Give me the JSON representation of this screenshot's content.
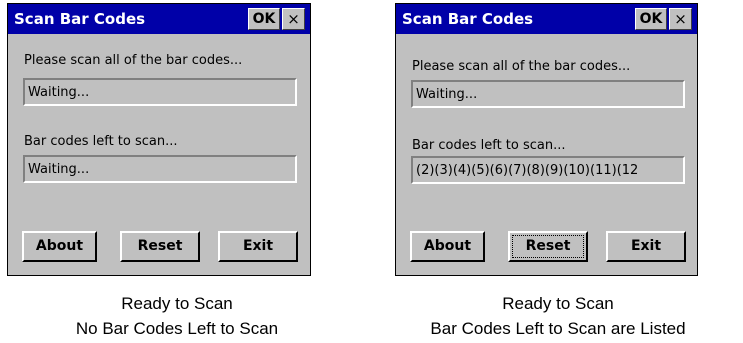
{
  "screens": [
    {
      "title": "Scan Bar Codes",
      "ok_label": "OK",
      "close_label": "×",
      "prompt_label": "Please scan all of the bar codes...",
      "scan_status": "Waiting...",
      "left_label": "Bar codes left to scan...",
      "left_value": "Waiting...",
      "buttons": {
        "about": "About",
        "reset": "Reset",
        "exit": "Exit"
      },
      "caption": [
        "Ready to Scan",
        "No Bar Codes Left to Scan"
      ]
    },
    {
      "title": "Scan Bar Codes",
      "ok_label": "OK",
      "close_label": "×",
      "prompt_label": "Please scan all of the bar codes...",
      "scan_status": "Waiting...",
      "left_label": "Bar codes left to scan...",
      "left_value": "(2)(3)(4)(5)(6)(7)(8)(9)(10)(11)(12",
      "buttons": {
        "about": "About",
        "reset": "Reset",
        "exit": "Exit"
      },
      "caption": [
        "Ready to Scan",
        "Bar Codes Left to Scan are Listed"
      ]
    }
  ],
  "colors": {
    "titlebar": "#0000a8",
    "dialog_bg": "#c0c0c0"
  }
}
